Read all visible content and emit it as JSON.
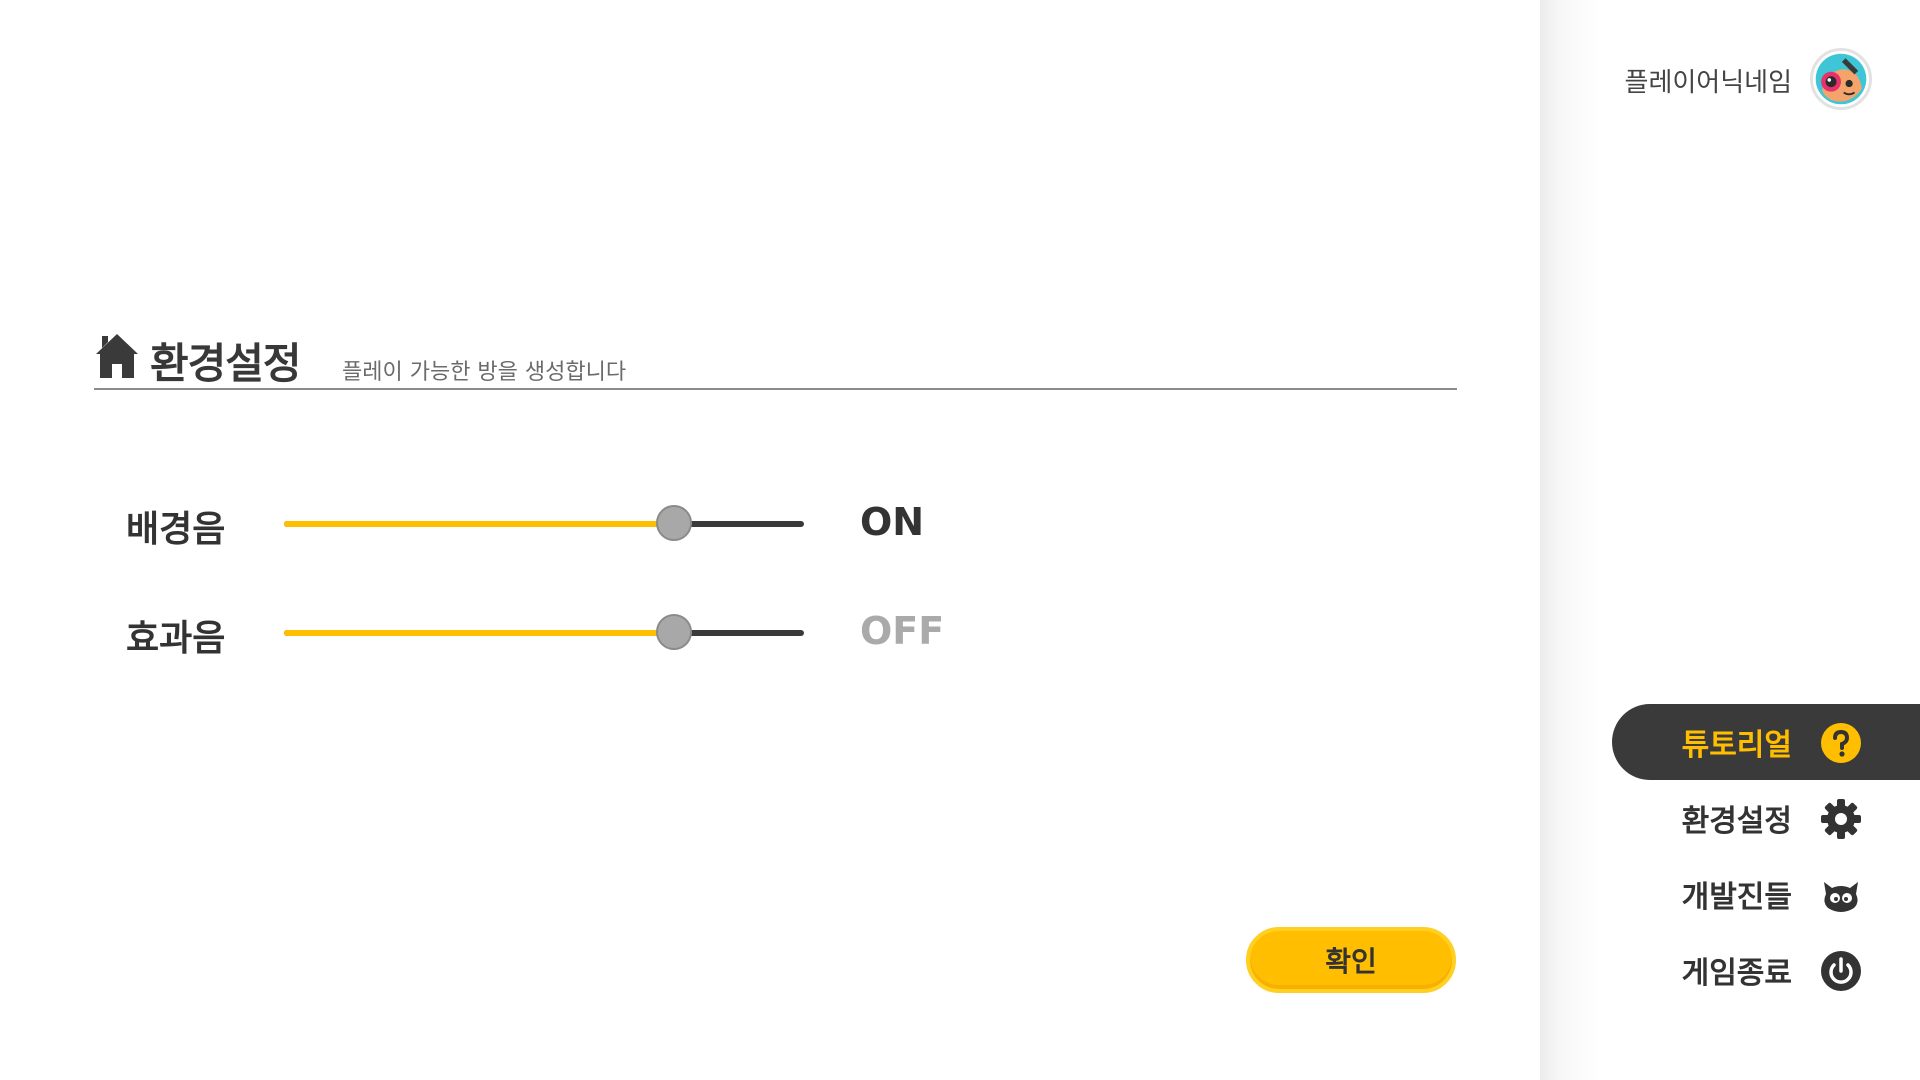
{
  "header": {
    "player_name": "플레이어닉네임"
  },
  "section": {
    "title": "환경설정",
    "subtitle": "플레이 가능한 방을 생성합니다"
  },
  "settings": [
    {
      "label": "배경음",
      "level": 0.75,
      "toggle": "ON",
      "state": "on"
    },
    {
      "label": "효과음",
      "level": 0.75,
      "toggle": "OFF",
      "state": "off"
    }
  ],
  "confirm_label": "확인",
  "menu": {
    "items": [
      {
        "label": "튜토리얼",
        "icon": "help-circle-icon",
        "active": true
      },
      {
        "label": "환경설정",
        "icon": "gear-icon",
        "active": false
      },
      {
        "label": "개발진들",
        "icon": "developers-icon",
        "active": false
      },
      {
        "label": "게임종료",
        "icon": "power-icon",
        "active": false
      }
    ]
  },
  "colors": {
    "accent": "#ffbf00",
    "dark": "#3a3a3a",
    "text": "#333333",
    "muted": "#aaaaaa"
  }
}
